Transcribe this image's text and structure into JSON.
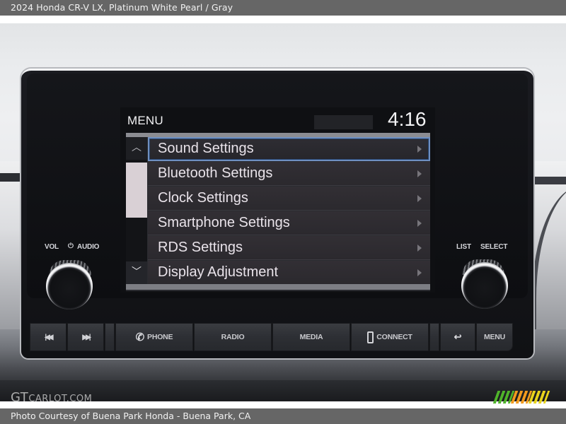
{
  "header": {
    "title": "2024 Honda CR-V LX,  Platinum White Pearl / Gray"
  },
  "footer": {
    "credit": "Photo Courtesy of Buena Park Honda - Buena Park, CA"
  },
  "watermark": {
    "brand_big": "GT",
    "brand_small": "CARLOT.COM",
    "logo_colors": [
      "#4fb32a",
      "#f29a1d",
      "#e8d31b"
    ]
  },
  "screen": {
    "title": "MENU",
    "clock": "4:16",
    "scroll_up_icon": "chevron-up",
    "scroll_down_icon": "chevron-down",
    "scroll_up_glyph": "︿",
    "scroll_down_glyph": "﹀",
    "selected_index": 0,
    "selection_color": "#6f8fc0",
    "items": [
      {
        "label": "Sound Settings"
      },
      {
        "label": "Bluetooth Settings"
      },
      {
        "label": "Clock Settings"
      },
      {
        "label": "Smartphone Settings"
      },
      {
        "label": "RDS Settings"
      },
      {
        "label": "Display Adjustment"
      }
    ]
  },
  "knobs": {
    "left": {
      "label_vol": "VOL",
      "label_audio": "AUDIO",
      "power_glyph": "⏻"
    },
    "right": {
      "label_list": "LIST",
      "label_select": "SELECT"
    }
  },
  "buttons": {
    "prev_track": {
      "glyph": "|◀◀",
      "icon": "skip-back"
    },
    "next_track": {
      "glyph": "▶▶|",
      "icon": "skip-forward"
    },
    "phone": {
      "label": "PHONE",
      "glyph": "✆"
    },
    "radio": {
      "label": "RADIO"
    },
    "media": {
      "label": "MEDIA"
    },
    "connect": {
      "label": "CONNECT"
    },
    "back": {
      "glyph": "↩",
      "icon": "back"
    },
    "menu": {
      "label": "MENU"
    }
  }
}
